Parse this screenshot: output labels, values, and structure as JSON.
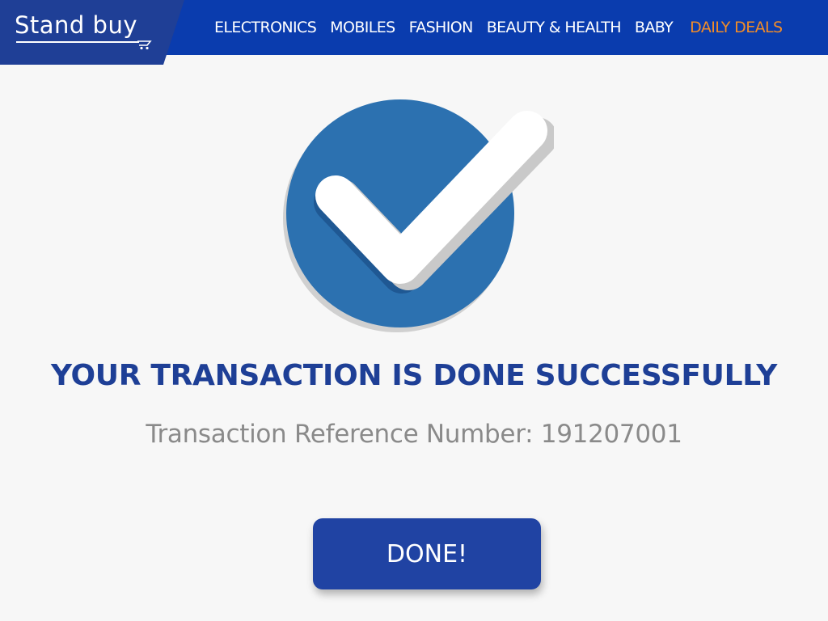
{
  "brand": {
    "logo_text": "Stand buy",
    "cart_icon": "cart-icon"
  },
  "nav": {
    "items": [
      {
        "label": "ELECTRONICS"
      },
      {
        "label": "MOBILES"
      },
      {
        "label": "FASHION"
      },
      {
        "label": "BEAUTY & HEALTH"
      },
      {
        "label": "BABY"
      }
    ],
    "deals_label": "DAILY DEALS",
    "deals_color": "#f28c28"
  },
  "success": {
    "icon": "check-circle-icon",
    "title": "YOUR TRANSACTION IS DONE SUCCESSFULLY",
    "reference_label": "Transaction Reference Number:",
    "reference_number": "191207001"
  },
  "actions": {
    "done_label": "DONE!"
  },
  "colors": {
    "header_bg": "#0a3cae",
    "logo_bg": "#1f3f96",
    "accent": "#2c71b0",
    "title": "#1e3f96",
    "button": "#2043a3"
  }
}
